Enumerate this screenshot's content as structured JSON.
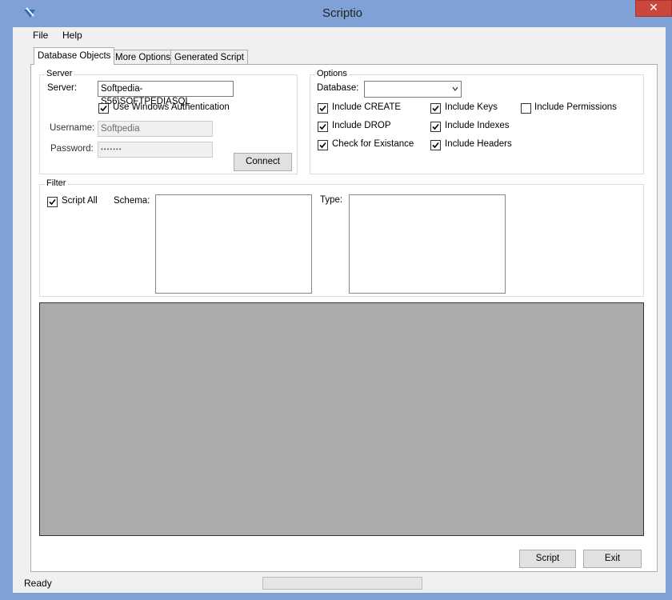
{
  "window": {
    "title": "Scriptio",
    "close_label": "✕",
    "accent": "#7FA1D6"
  },
  "menu": {
    "items": [
      "File",
      "Help"
    ]
  },
  "tabs": [
    {
      "label": "Database Objects",
      "active": true
    },
    {
      "label": "More Options",
      "active": false
    },
    {
      "label": "Generated Script",
      "active": false
    }
  ],
  "server_group": {
    "legend": "Server",
    "server_label": "Server:",
    "server_value": "Softpedia-S56\\SOFTPEDIASQL",
    "windows_auth_label": "Use Windows Authentication",
    "windows_auth_checked": true,
    "username_label": "Username:",
    "username_value": "Softpedia",
    "password_label": "Password:",
    "password_value": "•••••••",
    "connect_label": "Connect"
  },
  "options_group": {
    "legend": "Options",
    "database_label": "Database:",
    "database_value": "",
    "checks": {
      "include_create": {
        "label": "Include CREATE",
        "checked": true
      },
      "include_drop": {
        "label": "Include DROP",
        "checked": true
      },
      "check_existance": {
        "label": "Check for Existance",
        "checked": true
      },
      "include_keys": {
        "label": "Include Keys",
        "checked": true
      },
      "include_indexes": {
        "label": "Include Indexes",
        "checked": true
      },
      "include_headers": {
        "label": "Include Headers",
        "checked": true
      },
      "include_permissions": {
        "label": "Include Permissions",
        "checked": false
      }
    }
  },
  "filter_group": {
    "legend": "Filter",
    "script_all_label": "Script All",
    "script_all_checked": true,
    "schema_label": "Schema:",
    "type_label": "Type:",
    "schema_items": [],
    "type_items": []
  },
  "buttons": {
    "script_label": "Script",
    "exit_label": "Exit"
  },
  "status": {
    "text": "Ready",
    "progress": 0,
    "progress_color": "#06B025"
  }
}
